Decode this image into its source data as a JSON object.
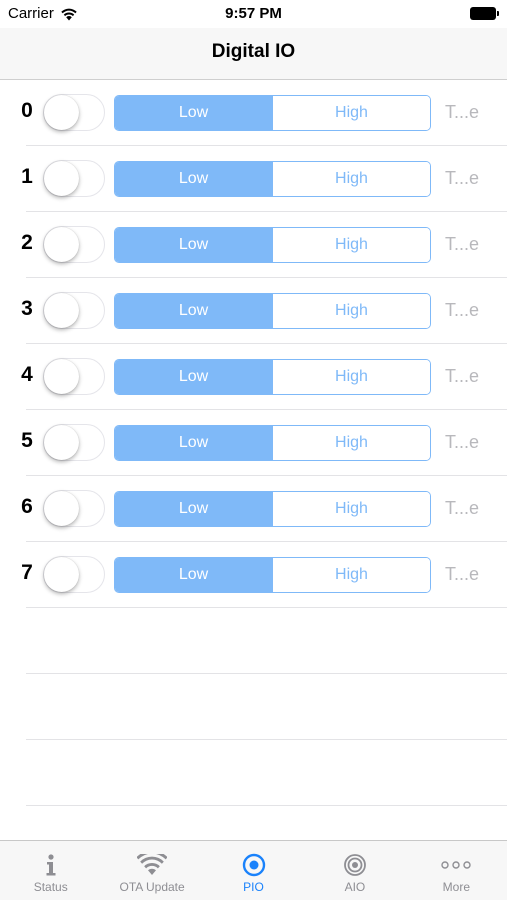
{
  "status_bar": {
    "carrier": "Carrier",
    "time": "9:57 PM"
  },
  "nav": {
    "title": "Digital IO"
  },
  "segment_labels": {
    "low": "Low",
    "high": "High"
  },
  "rows": [
    {
      "pin": "0",
      "switch_on": false,
      "selected": "Low",
      "label": "T...e"
    },
    {
      "pin": "1",
      "switch_on": false,
      "selected": "Low",
      "label": "T...e"
    },
    {
      "pin": "2",
      "switch_on": false,
      "selected": "Low",
      "label": "T...e"
    },
    {
      "pin": "3",
      "switch_on": false,
      "selected": "Low",
      "label": "T...e"
    },
    {
      "pin": "4",
      "switch_on": false,
      "selected": "Low",
      "label": "T...e"
    },
    {
      "pin": "5",
      "switch_on": false,
      "selected": "Low",
      "label": "T...e"
    },
    {
      "pin": "6",
      "switch_on": false,
      "selected": "Low",
      "label": "T...e"
    },
    {
      "pin": "7",
      "switch_on": false,
      "selected": "Low",
      "label": "T...e"
    }
  ],
  "tabs": [
    {
      "label": "Status",
      "icon": "info-icon",
      "active": false
    },
    {
      "label": "OTA Update",
      "icon": "wifi-icon",
      "active": false
    },
    {
      "label": "PIO",
      "icon": "pio-icon",
      "active": true
    },
    {
      "label": "AIO",
      "icon": "aio-icon",
      "active": false
    },
    {
      "label": "More",
      "icon": "more-icon",
      "active": false
    }
  ],
  "colors": {
    "accent": "#1a82fb",
    "segment": "#7fb9f8",
    "inactive": "#8e8e93"
  }
}
